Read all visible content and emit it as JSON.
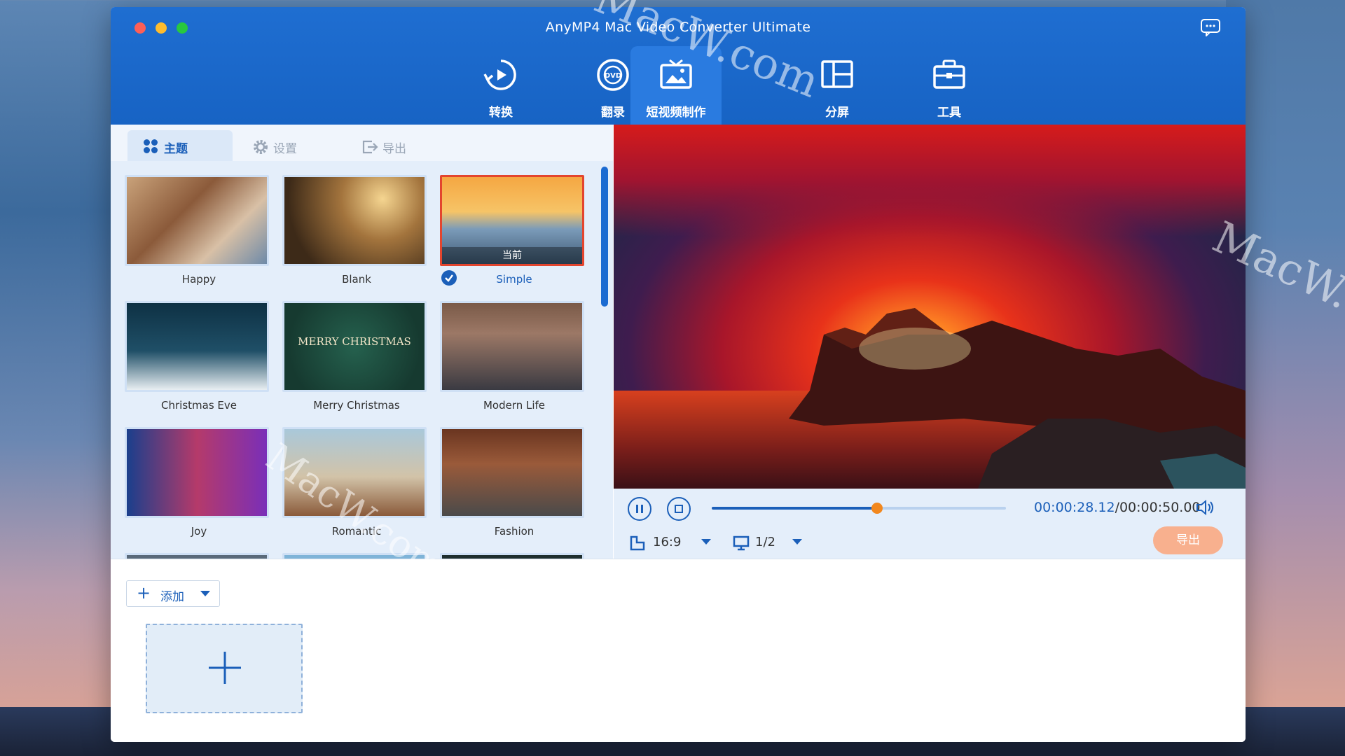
{
  "window": {
    "title": "AnyMP4 Mac Video Converter Ultimate"
  },
  "nav": [
    {
      "label": "转换",
      "icon": "convert-icon"
    },
    {
      "label": "翻录",
      "icon": "dvd-icon"
    },
    {
      "label": "短视频制作",
      "icon": "mv-maker-icon",
      "active": true
    },
    {
      "label": "分屏",
      "icon": "collage-icon"
    },
    {
      "label": "工具",
      "icon": "toolbox-icon"
    }
  ],
  "tabs": [
    {
      "label": "主题",
      "icon": "grid-icon",
      "active": true
    },
    {
      "label": "设置",
      "icon": "gear-icon"
    },
    {
      "label": "导出",
      "icon": "export-icon"
    }
  ],
  "themes": [
    {
      "name": "Happy"
    },
    {
      "name": "Blank"
    },
    {
      "name": "Simple",
      "selected": true,
      "tag": "当前"
    },
    {
      "name": "Christmas Eve"
    },
    {
      "name": "Merry Christmas",
      "art_text": "MERRY CHRISTMAS"
    },
    {
      "name": "Modern Life"
    },
    {
      "name": "Joy"
    },
    {
      "name": "Romantic"
    },
    {
      "name": "Fashion"
    }
  ],
  "player": {
    "current_time": "00:00:28.12",
    "total_time": "00:00:50.00",
    "progress": 0.5624,
    "aspect_ratio": "16:9",
    "screen": "1/2",
    "export_label": "导出"
  },
  "bottom": {
    "add_label": "添加"
  },
  "watermark": {
    "text": "MacW.com"
  },
  "colors": {
    "accent": "#1b5fb9",
    "titlebar": "#1763c4",
    "selected_border": "#e3452e",
    "knob": "#f2871d",
    "export_button": "#f8b08e"
  }
}
